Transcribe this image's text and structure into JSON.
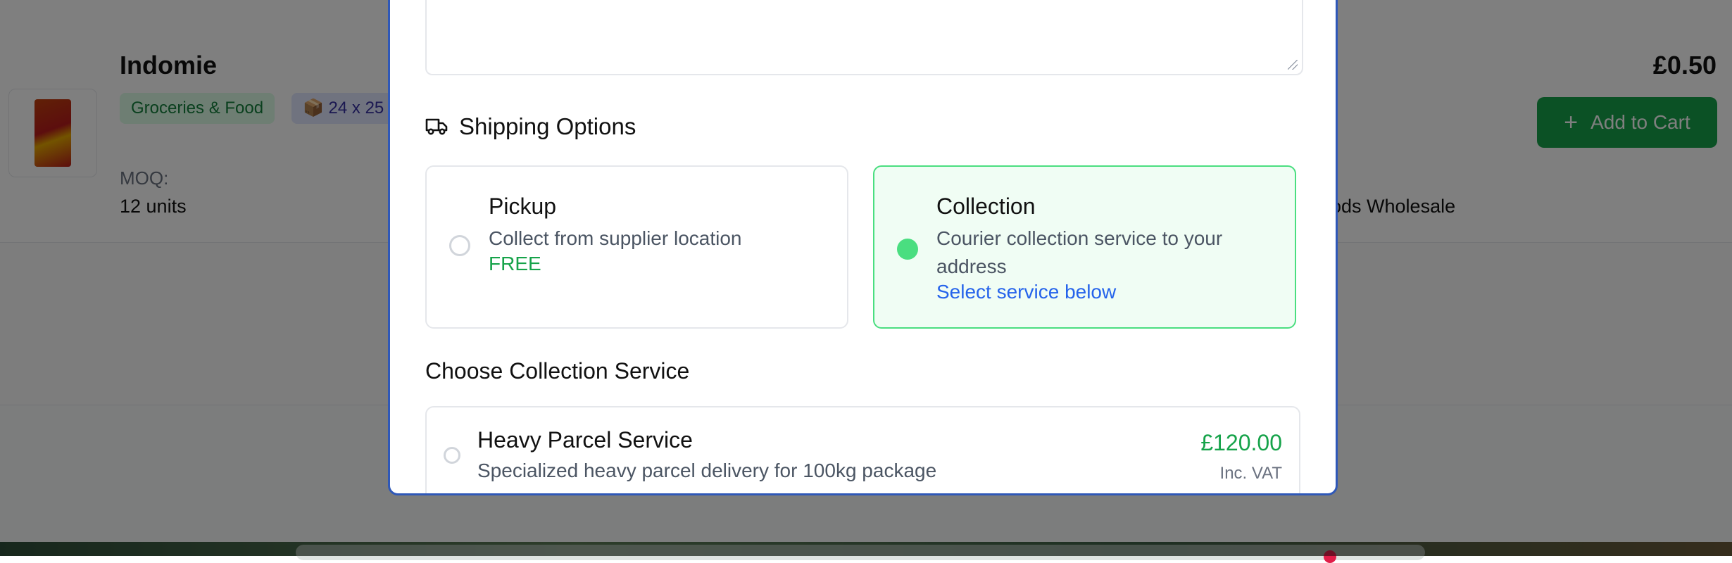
{
  "background": {
    "product": {
      "name": "Indomie",
      "category": "Groceries & Food",
      "pack_size": "📦 24 x 25",
      "moq_label": "MOQ:",
      "moq_value": "12 units",
      "price": "£0.50",
      "add_to_cart_label": "Add to Cart",
      "supplier_fragment": "ods Wholesale"
    }
  },
  "modal": {
    "shipping": {
      "title": "Shipping Options",
      "options": [
        {
          "title": "Pickup",
          "description": "Collect from supplier location",
          "note": "FREE",
          "selected": false
        },
        {
          "title": "Collection",
          "description": "Courier collection service to your address",
          "note": "Select service below",
          "selected": true
        }
      ]
    },
    "collection": {
      "title": "Choose Collection Service",
      "services": [
        {
          "name": "Heavy Parcel Service",
          "description": "Specialized heavy parcel delivery for 100kg package",
          "price": "£120.00",
          "vat_note": "Inc. VAT"
        }
      ]
    }
  },
  "colors": {
    "accent_green": "#16a34a",
    "selected_border": "#4ade80",
    "link_blue": "#2563eb",
    "modal_border": "#2f58b8"
  }
}
